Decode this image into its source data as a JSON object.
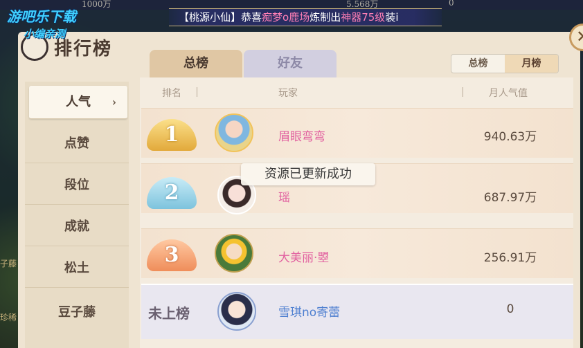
{
  "top_bar": {
    "currency_1": "1000万",
    "currency_2": "5.568万",
    "currency_3": "0"
  },
  "announcement": {
    "prefix": "【桃源小仙】恭喜",
    "player": "痴梦o鹿场",
    "middle": "炼制出",
    "item": "神器75级",
    "suffix": "装i"
  },
  "watermark": {
    "line1": "游吧乐下载",
    "line2": "小编亲测"
  },
  "panel": {
    "title": "排行榜",
    "close_label": "✕"
  },
  "tabs": {
    "total": "总榜",
    "friends": "好友"
  },
  "segment": {
    "total": "总榜",
    "month": "月榜",
    "selected": "月榜"
  },
  "sidebar": {
    "items": [
      {
        "label": "人气",
        "active": true
      },
      {
        "label": "点赞",
        "active": false
      },
      {
        "label": "段位",
        "active": false
      },
      {
        "label": "成就",
        "active": false
      },
      {
        "label": "松土",
        "active": false
      },
      {
        "label": "豆子藤",
        "active": false
      }
    ]
  },
  "table": {
    "headers": {
      "rank": "排名",
      "player": "玩家",
      "value": "月人气值"
    },
    "rows": [
      {
        "rank": "1",
        "name": "眉眼弯弯",
        "value": "940.63万"
      },
      {
        "rank": "2",
        "name": "瑶",
        "value": "687.97万"
      },
      {
        "rank": "3",
        "name": "大美丽·曌",
        "value": "256.91万"
      }
    ],
    "self": {
      "rank": "未上榜",
      "name": "雪琪no寄蕾",
      "value": "0"
    }
  },
  "toast": "资源已更新成功",
  "left_edge": {
    "label_1": "子藤",
    "label_2": "珍稀"
  },
  "colors": {
    "panel_bg": "#efe4d2",
    "player_name": "#e15f9f",
    "self_name": "#4e7fd0",
    "accent_gold": "#e2a93b"
  }
}
